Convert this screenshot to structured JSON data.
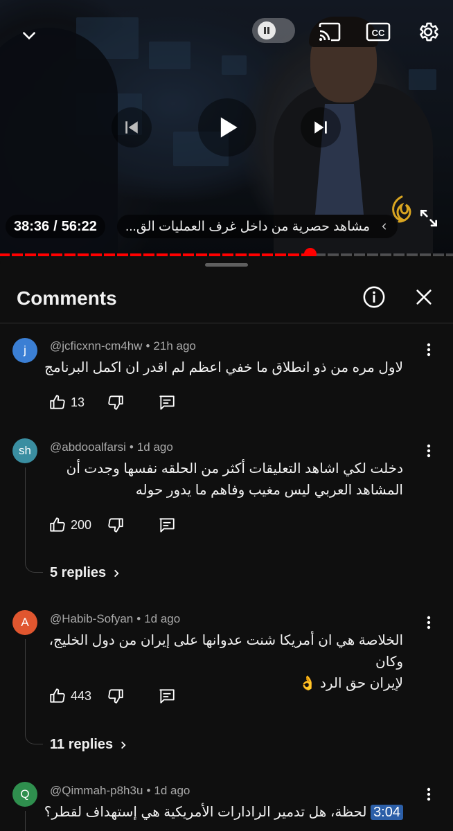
{
  "player": {
    "current_time": "38:36",
    "separator": "/",
    "duration": "56:22",
    "chapter_title": "مشاهد حصرية من داخل غرف العمليات الق...",
    "progress_fraction": 0.685,
    "icons": [
      "chevron-down-icon",
      "pause-icon",
      "cast-icon",
      "cc-icon",
      "settings-icon",
      "previous-icon",
      "play-icon",
      "next-icon",
      "chevron-left-icon",
      "fullscreen-icon"
    ]
  },
  "comments_panel": {
    "title": "Comments",
    "icons": [
      "info-icon",
      "close-icon"
    ]
  },
  "comments": [
    {
      "avatar_letter": "j",
      "avatar_color": "#3b7fd4",
      "author": "@jcficxnn-cm4hw",
      "time": "21h ago",
      "lines": [
        "لاول مره من ذو انطلاق ما خفي اعظم لم اقدر ان اكمل البرنامج"
      ],
      "likes": "13"
    },
    {
      "avatar_letter": "sh",
      "avatar_color": "#3a8ea1",
      "author": "@abdooalfarsi",
      "time": "1d ago",
      "lines": [
        "دخلت لكي اشاهد التعليقات أكثر من الحلقه نفسها وجدت أن",
        "المشاهد العربي ليس مغيب وفاهم ما يدور حوله"
      ],
      "likes": "200",
      "replies": "5 replies"
    },
    {
      "avatar_letter": "A",
      "avatar_color": "#e0562f",
      "author": "@Habib-Sofyan",
      "time": "1d ago",
      "lines": [
        "الخلاصة هي ان أمريكا شنت عدوانها على إيران من دول الخليج، وكان",
        "لإيران حق الرد 👌"
      ],
      "likes": "443",
      "replies": "11 replies"
    },
    {
      "avatar_letter": "Q",
      "avatar_color": "#2f8f4e",
      "author": "@Qimmah-p8h3u",
      "time": "1d ago",
      "timestamp": "3:04",
      "lines": [
        "لحظة، هل تدمير الرادارات الأمريكية هي إستهداف لقطر؟ مع"
      ]
    }
  ]
}
